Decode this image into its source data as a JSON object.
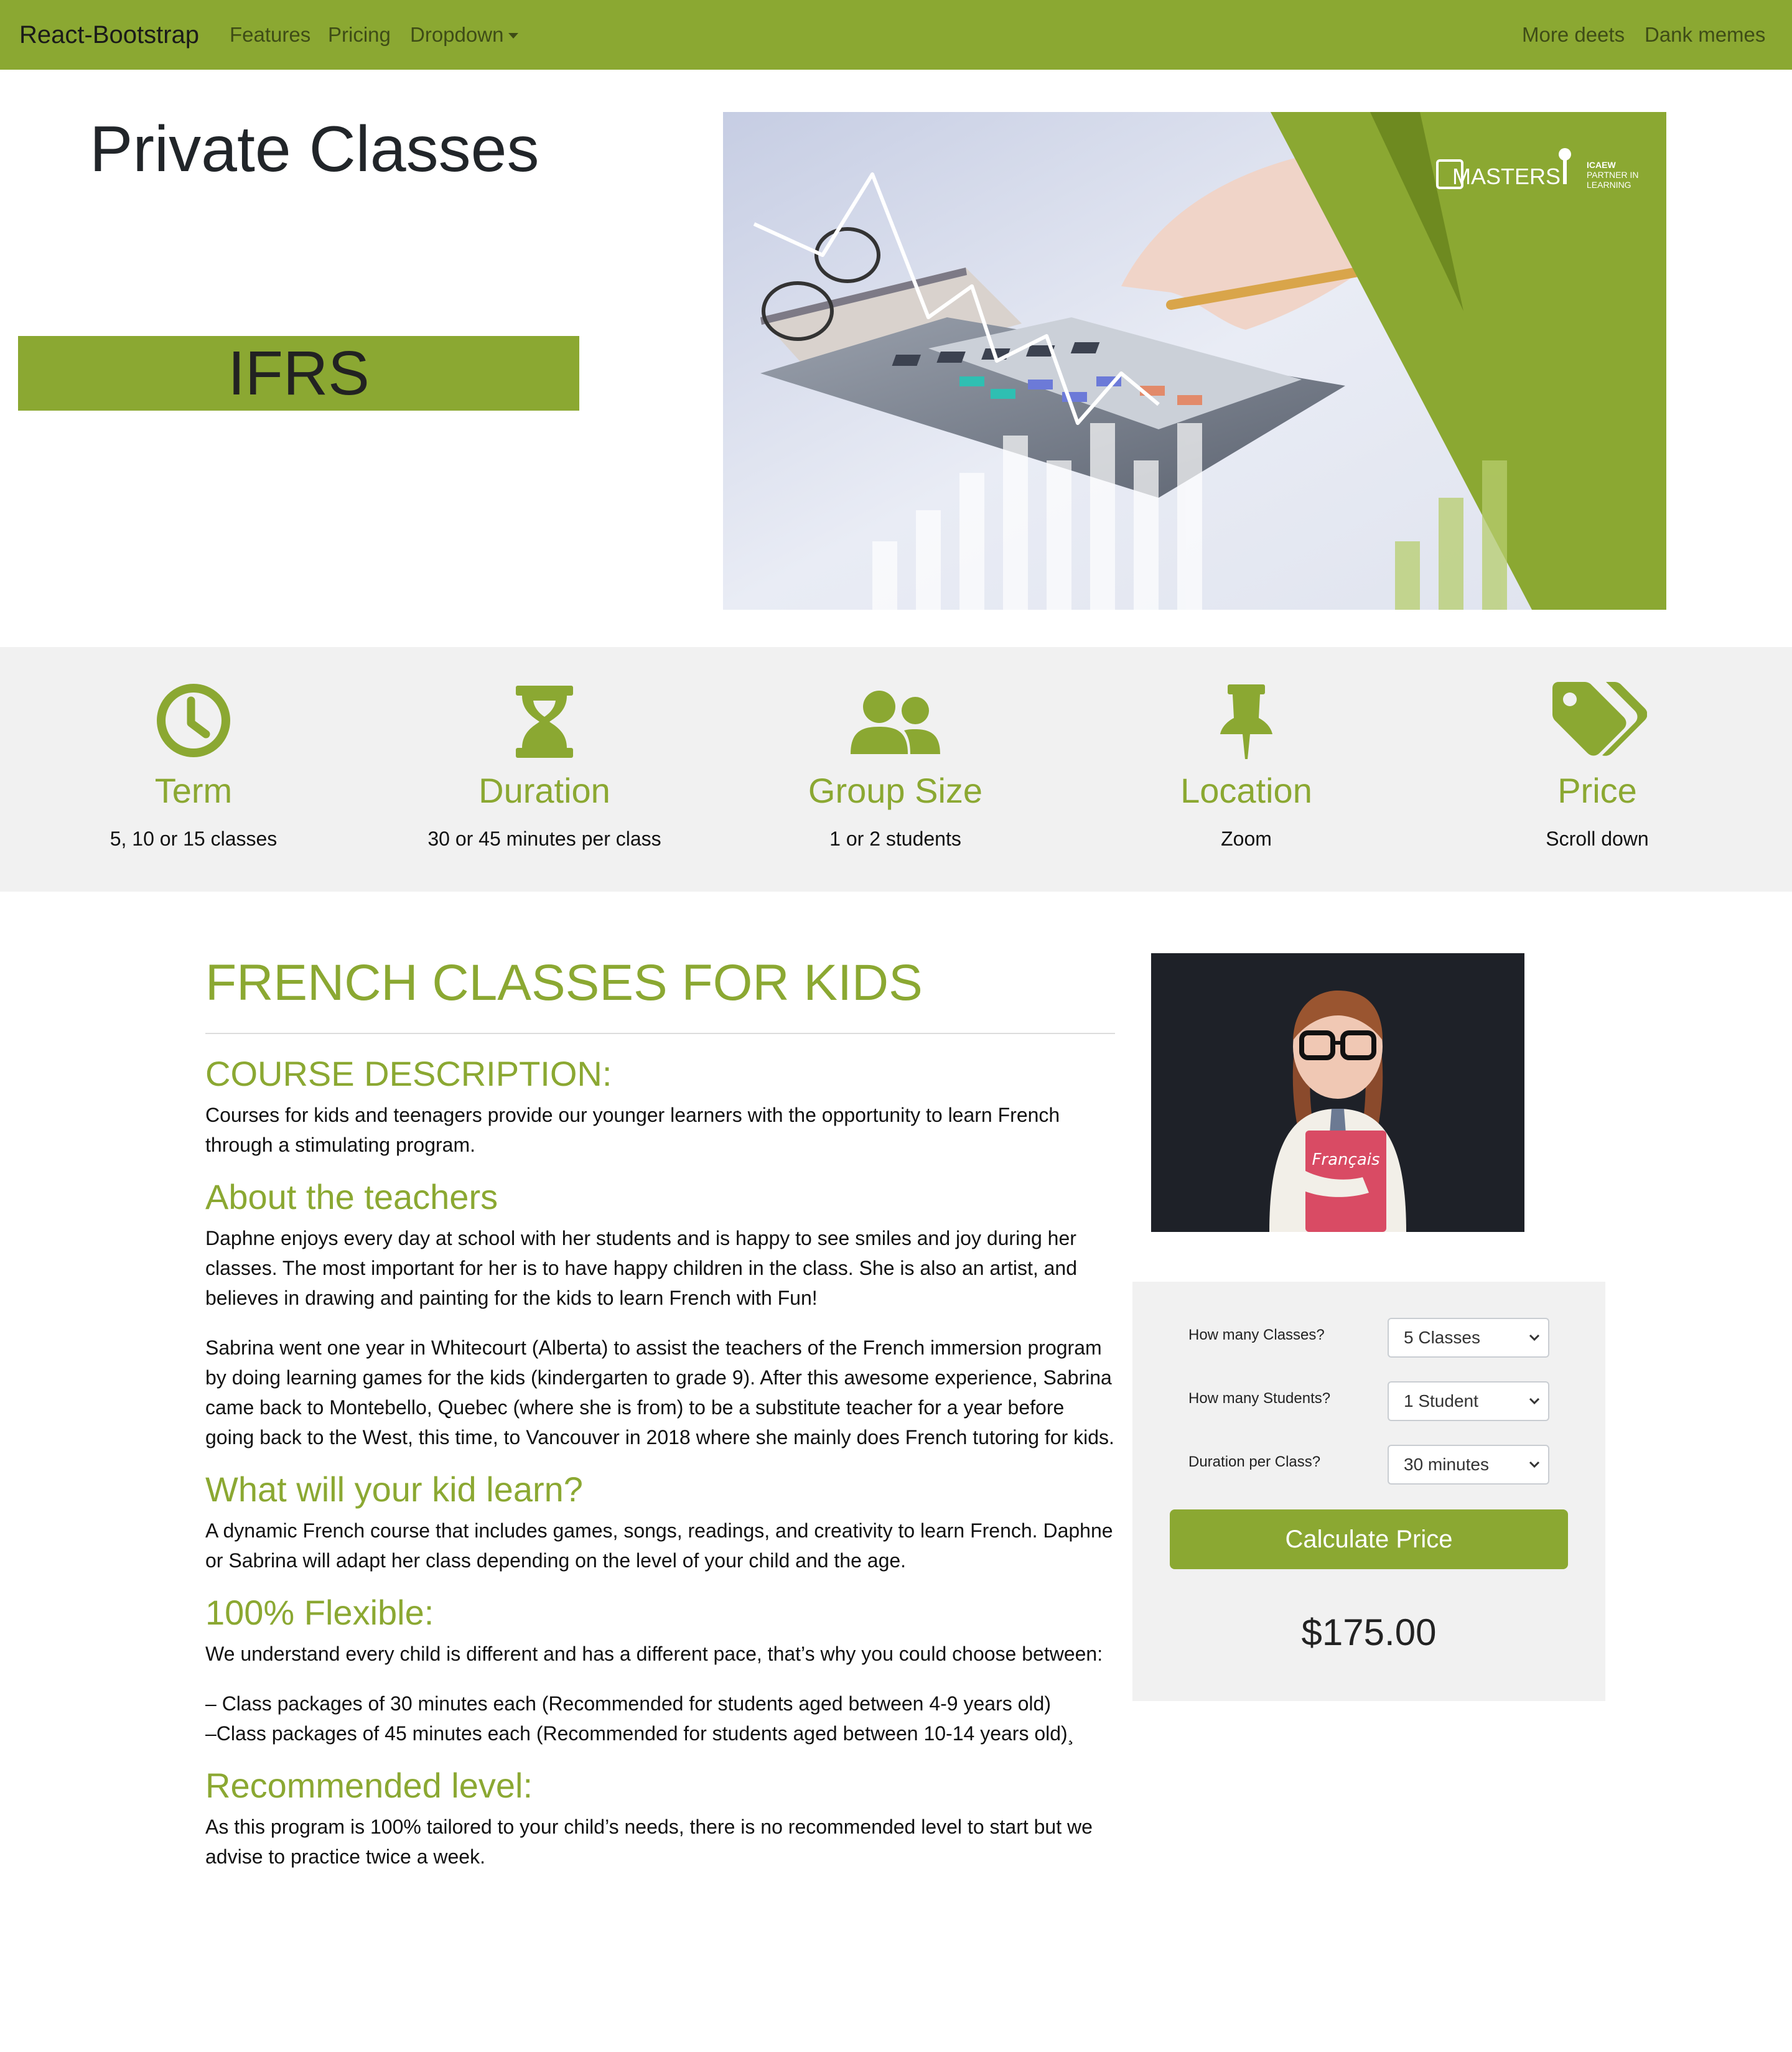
{
  "navbar": {
    "brand": "React-Bootstrap",
    "links": [
      "Features",
      "Pricing",
      "Dropdown"
    ],
    "right_links": [
      "More deets",
      "Dank memes"
    ],
    "background": "#8ba832"
  },
  "hero": {
    "title": "Private Classes",
    "badge": "IFRS",
    "image": {
      "description_icon": "calculator-finance-photo",
      "logo_text": "MASTERS",
      "partner_text": [
        "ICAEW",
        "PARTNER IN",
        "LEARNING"
      ]
    }
  },
  "features": [
    {
      "icon": "clock-icon",
      "title": "Term",
      "desc": "5, 10 or 15 classes"
    },
    {
      "icon": "hourglass-icon",
      "title": "Duration",
      "desc": "30 or 45 minutes per class"
    },
    {
      "icon": "users-icon",
      "title": "Group Size",
      "desc": "1 or 2 students"
    },
    {
      "icon": "thumbtack-icon",
      "title": "Location",
      "desc": "Zoom"
    },
    {
      "icon": "tags-icon",
      "title": "Price",
      "desc": "Scroll down"
    }
  ],
  "article": {
    "title": "FRENCH CLASSES FOR KIDS",
    "course_heading": "COURSE DESCRIPTION:",
    "course_text": "Courses for kids and teenagers provide our younger learners with the opportunity to learn French through a stimulating program.",
    "teachers_heading": "About the teachers",
    "teachers_p1": "Daphne enjoys every day at school with her students and is happy to see smiles and joy during her classes. The most important for her is to have happy children in the class. She is also an artist, and believes in drawing and painting for the kids to learn French with Fun!",
    "teachers_p2": "Sabrina went one year in Whitecourt (Alberta) to assist the teachers of the French immersion program by doing learning games for the kids (kindergarten to grade 9). After this awesome experience, Sabrina came back to Montebello, Quebec (where she is from) to be a substitute teacher for a year before going back to the West, this time, to Vancouver in 2018 where she mainly does French tutoring for kids.",
    "learn_heading": "What will your kid learn?",
    "learn_text": "A dynamic French course that includes games, songs, readings, and creativity to learn French. Daphne or Sabrina will adapt her class depending on the level of your child and the age.",
    "flex_heading": "100% Flexible:",
    "flex_text": "We understand every child is different and has a different pace, that’s why you could choose between:",
    "flex_item1": "– Class packages of 30 minutes each (Recommended for students aged between 4-9 years old)",
    "flex_item2": "–Class packages of 45 minutes each (Recommended for students aged between 10-14 years old)¸",
    "level_heading": "Recommended level:",
    "level_text": "As this program is 100% tailored to your child’s needs, there is no recommended level to start but we advise to practice twice a week."
  },
  "side": {
    "photo_book_text": "Français"
  },
  "calculator": {
    "classes_label": "How many Classes?",
    "classes_value": "5 Classes",
    "students_label": "How many Students?",
    "students_value": "1 Student",
    "duration_label": "Duration per Class?",
    "duration_value": "30 minutes",
    "button_label": "Calculate Price",
    "price": "$175.00"
  },
  "colors": {
    "accent": "#8ba832",
    "strip_background": "#f1f1f1"
  }
}
